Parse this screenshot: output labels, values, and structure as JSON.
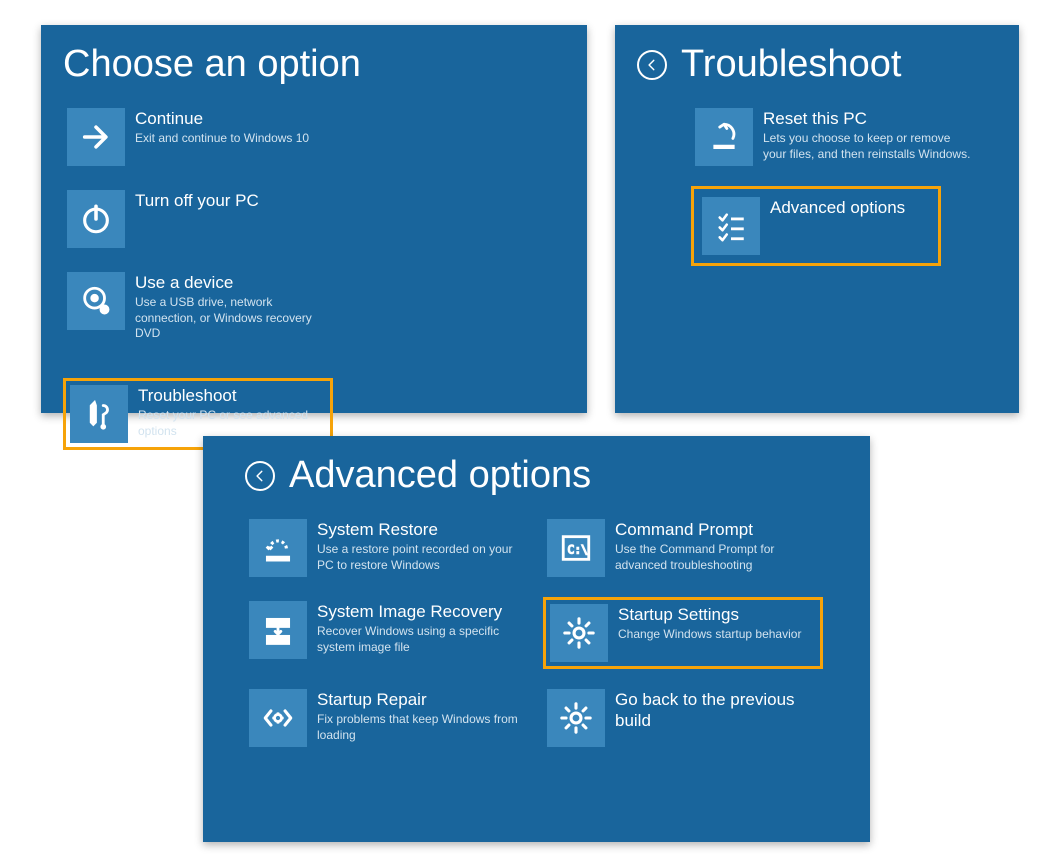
{
  "panel1": {
    "title": "Choose an option",
    "tiles": {
      "continue": {
        "title": "Continue",
        "desc": "Exit and continue to Windows 10"
      },
      "turnoff": {
        "title": "Turn off your PC",
        "desc": ""
      },
      "device": {
        "title": "Use a device",
        "desc": "Use a USB drive, network connection, or Windows recovery DVD"
      },
      "trouble": {
        "title": "Troubleshoot",
        "desc": "Reset your PC or see advanced options"
      }
    }
  },
  "panel2": {
    "title": "Troubleshoot",
    "tiles": {
      "reset": {
        "title": "Reset this PC",
        "desc": "Lets you choose to keep or remove your files, and then reinstalls Windows."
      },
      "advanced": {
        "title": "Advanced options",
        "desc": ""
      }
    }
  },
  "panel3": {
    "title": "Advanced options",
    "tiles": {
      "restore": {
        "title": "System Restore",
        "desc": "Use a restore point recorded on your PC to restore Windows"
      },
      "cmd": {
        "title": "Command Prompt",
        "desc": "Use the Command Prompt for advanced troubleshooting"
      },
      "image": {
        "title": "System Image Recovery",
        "desc": "Recover Windows using a specific system image file"
      },
      "startup": {
        "title": "Startup Settings",
        "desc": "Change Windows startup behavior"
      },
      "repair": {
        "title": "Startup Repair",
        "desc": "Fix problems that keep Windows from loading"
      },
      "goback": {
        "title": "Go back to the previous build",
        "desc": ""
      }
    }
  }
}
